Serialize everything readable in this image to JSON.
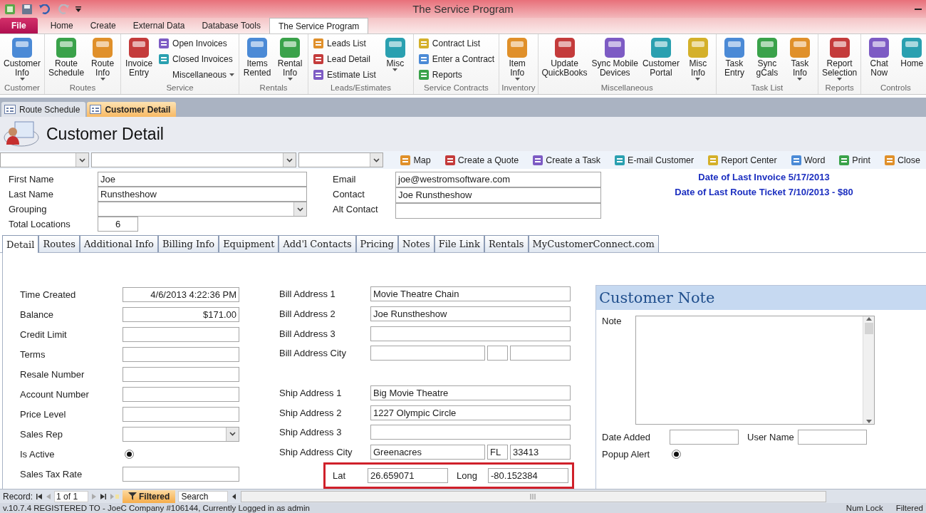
{
  "window": {
    "title": "The Service Program"
  },
  "ribbon_tabs": [
    {
      "label": "File",
      "kind": "file",
      "selected": false
    },
    {
      "label": "Home",
      "kind": "tab",
      "selected": false
    },
    {
      "label": "Create",
      "kind": "tab",
      "selected": false
    },
    {
      "label": "External Data",
      "kind": "tab",
      "selected": false
    },
    {
      "label": "Database Tools",
      "kind": "tab",
      "selected": false
    },
    {
      "label": "The Service Program",
      "kind": "tab",
      "selected": true
    }
  ],
  "ribbon_groups": [
    {
      "label": "Customer",
      "items": [
        {
          "kind": "large",
          "label": "Customer\nInfo",
          "dropdown": true
        }
      ]
    },
    {
      "label": "Routes",
      "items": [
        {
          "kind": "large",
          "label": "Route\nSchedule",
          "dropdown": false
        },
        {
          "kind": "large",
          "label": "Route\nInfo",
          "dropdown": true
        }
      ]
    },
    {
      "label": "Service",
      "items": [
        {
          "kind": "large",
          "label": "Invoice\nEntry",
          "dropdown": false
        },
        {
          "kind": "stack",
          "items": [
            {
              "label": "Open Invoices",
              "icon": true,
              "dropdown": false
            },
            {
              "label": "Closed Invoices",
              "icon": true,
              "dropdown": false
            },
            {
              "label": "Miscellaneous",
              "icon": false,
              "dropdown": true
            }
          ]
        }
      ]
    },
    {
      "label": "Rentals",
      "items": [
        {
          "kind": "large",
          "label": "Items\nRented",
          "dropdown": false
        },
        {
          "kind": "large",
          "label": "Rental\nInfo",
          "dropdown": true
        }
      ]
    },
    {
      "label": "Leads/Estimates",
      "items": [
        {
          "kind": "stack",
          "items": [
            {
              "label": "Leads List",
              "icon": true,
              "dropdown": false
            },
            {
              "label": "Lead Detail",
              "icon": true,
              "dropdown": false
            },
            {
              "label": "Estimate List",
              "icon": true,
              "dropdown": false
            }
          ]
        },
        {
          "kind": "large",
          "label": "Misc",
          "dropdown": true
        }
      ]
    },
    {
      "label": "Service Contracts",
      "items": [
        {
          "kind": "stack",
          "items": [
            {
              "label": "Contract List",
              "icon": true,
              "dropdown": false
            },
            {
              "label": "Enter a Contract",
              "icon": true,
              "dropdown": false
            },
            {
              "label": "Reports",
              "icon": true,
              "dropdown": false
            }
          ]
        }
      ]
    },
    {
      "label": "Inventory",
      "items": [
        {
          "kind": "large",
          "label": "Item\nInfo",
          "dropdown": true
        }
      ]
    },
    {
      "label": "Miscellaneous",
      "items": [
        {
          "kind": "large",
          "label": "Update\nQuickBooks",
          "dropdown": false
        },
        {
          "kind": "large",
          "label": "Sync Mobile\nDevices",
          "dropdown": false
        },
        {
          "kind": "large",
          "label": "Customer\nPortal",
          "dropdown": false
        },
        {
          "kind": "large",
          "label": "Misc\nInfo",
          "dropdown": true
        }
      ]
    },
    {
      "label": "Task List",
      "items": [
        {
          "kind": "large",
          "label": "Task\nEntry",
          "dropdown": false
        },
        {
          "kind": "large",
          "label": "Sync\ngCals",
          "dropdown": false
        },
        {
          "kind": "large",
          "label": "Task\nInfo",
          "dropdown": true
        }
      ]
    },
    {
      "label": "Reports",
      "items": [
        {
          "kind": "large",
          "label": "Report\nSelection",
          "dropdown": true
        }
      ]
    },
    {
      "label": "Controls",
      "items": [
        {
          "kind": "large",
          "label": "Chat\nNow",
          "dropdown": false
        },
        {
          "kind": "large",
          "label": "Home",
          "dropdown": false
        }
      ]
    }
  ],
  "document_tabs": [
    {
      "label": "Route Schedule",
      "selected": false
    },
    {
      "label": "Customer Detail",
      "selected": true
    }
  ],
  "form_title": "Customer Detail",
  "toolbar": {
    "actions": [
      "Map",
      "Create a Quote",
      "Create a Task",
      "E-mail Customer",
      "Report Center",
      "Word",
      "Print",
      "Close"
    ]
  },
  "customer": [
    {
      "label": "First Name",
      "value": "Joe",
      "kind": "text"
    },
    {
      "label": "Last Name",
      "value": "Runstheshow",
      "kind": "text"
    },
    {
      "label": "Grouping",
      "kind": "combo"
    },
    {
      "label": "Total Locations",
      "value": "6",
      "kind": "short"
    }
  ],
  "contact": [
    {
      "label": "Email",
      "value": "joe@westromsoftware.com"
    },
    {
      "label": "Contact",
      "value": "Joe Runstheshow"
    },
    {
      "label": "Alt Contact"
    }
  ],
  "summary": [
    "Date of Last Invoice 5/17/2013",
    "Date of Last Route Ticket 7/10/2013 - $80"
  ],
  "form_tabs": [
    {
      "label": "Detail",
      "selected": true
    },
    {
      "label": "Routes",
      "selected": false
    },
    {
      "label": "Additional Info",
      "selected": false
    },
    {
      "label": "Billing Info",
      "selected": false
    },
    {
      "label": "Equipment",
      "selected": false
    },
    {
      "label": "Add'l Contacts",
      "selected": false
    },
    {
      "label": "Pricing",
      "selected": false
    },
    {
      "label": "Notes",
      "selected": false
    },
    {
      "label": "File Link",
      "selected": false
    },
    {
      "label": "Rentals",
      "selected": false
    },
    {
      "label": "MyCustomerConnect.com",
      "selected": false
    }
  ],
  "detail_fields": [
    {
      "label": "Time Created",
      "value": "4/6/2013 4:22:36 PM",
      "kind": "right"
    },
    {
      "label": "Balance",
      "value": "$171.00",
      "kind": "right"
    },
    {
      "label": "Credit Limit",
      "kind": "text"
    },
    {
      "label": "Terms",
      "kind": "text"
    },
    {
      "label": "Resale Number",
      "kind": "text"
    },
    {
      "label": "Account Number",
      "kind": "text"
    },
    {
      "label": "Price Level",
      "kind": "text"
    },
    {
      "label": "Sales Rep",
      "kind": "combo"
    },
    {
      "label": "Is Active",
      "kind": "radio",
      "checked": true
    },
    {
      "label": "Sales Tax Rate",
      "kind": "text"
    }
  ],
  "address_groups": [
    [
      {
        "label": "Bill Address 1",
        "kind": "line",
        "value": "Movie Theatre Chain"
      },
      {
        "label": "Bill Address 2",
        "kind": "line",
        "value": "Joe Runstheshow"
      },
      {
        "label": "Bill Address 3",
        "kind": "line"
      },
      {
        "label": "Bill Address City",
        "kind": "city"
      }
    ],
    [
      {
        "label": "Ship Address 1",
        "kind": "line",
        "value": "Big Movie Theatre"
      },
      {
        "label": "Ship Address 2",
        "kind": "line",
        "value": "1227 Olympic Circle"
      },
      {
        "label": "Ship Address 3",
        "kind": "line"
      },
      {
        "label": "Ship Address City",
        "kind": "city",
        "city": "Greenacres",
        "state": "FL",
        "zip": "33413"
      }
    ]
  ],
  "coordinates": {
    "highlighted": true,
    "lat_label": "Lat",
    "lat": "26.659071",
    "long_label": "Long",
    "long": "-80.152384"
  },
  "customer_note": {
    "title": "Customer Note",
    "note_label": "Note",
    "date_added_label": "Date Added",
    "user_name_label": "User Name",
    "popup_label": "Popup Alert",
    "popup_checked": true
  },
  "record_nav": {
    "label": "Record:",
    "position": "1 of 1",
    "filter": "Filtered",
    "filter_on": true,
    "search_placeholder": "Search"
  },
  "status_bar": {
    "text": "v.10.7.4 REGISTERED TO - JoeC Company #106144, Currently Logged in as admin",
    "indicators": [
      "Num Lock",
      "Filtered"
    ]
  }
}
